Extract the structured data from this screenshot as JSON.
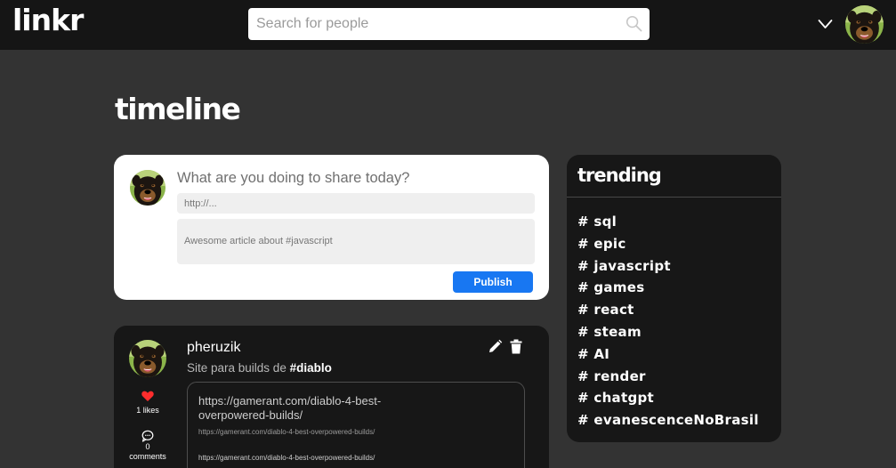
{
  "header": {
    "logo": "linkr",
    "search_placeholder": "Search for people"
  },
  "page_title": "timeline",
  "composer": {
    "question": "What are you doing to share today?",
    "url_placeholder": "http://...",
    "description_placeholder": "Awesome article about #javascript",
    "publish_label": "Publish"
  },
  "post": {
    "username": "pheruzik",
    "text_prefix": "Site para builds de ",
    "hashtag": "#diablo",
    "likes_label": "1 likes",
    "comments_count": "0",
    "comments_label": "comments",
    "link": {
      "title": "https://gamerant.com/diablo-4-best-overpowered-builds/",
      "description": "https://gamerant.com/diablo-4-best-overpowered-builds/",
      "url": "https://gamerant.com/diablo-4-best-overpowered-builds/"
    }
  },
  "trending": {
    "title": "trending",
    "hashtags": [
      "# sql",
      "# epic",
      "# javascript",
      "# games",
      "# react",
      "# steam",
      "# AI",
      "# render",
      "# chatgpt",
      "# evanescenceNoBrasil"
    ]
  },
  "colors": {
    "background": "#333333",
    "header": "#151515",
    "card_dark": "#171717",
    "accent_blue": "#1877f2",
    "like_red": "#ff2d2d"
  },
  "icons": [
    "search-icon",
    "chevron-down-icon",
    "edit-icon",
    "trash-icon",
    "heart-icon",
    "comment-icon"
  ]
}
